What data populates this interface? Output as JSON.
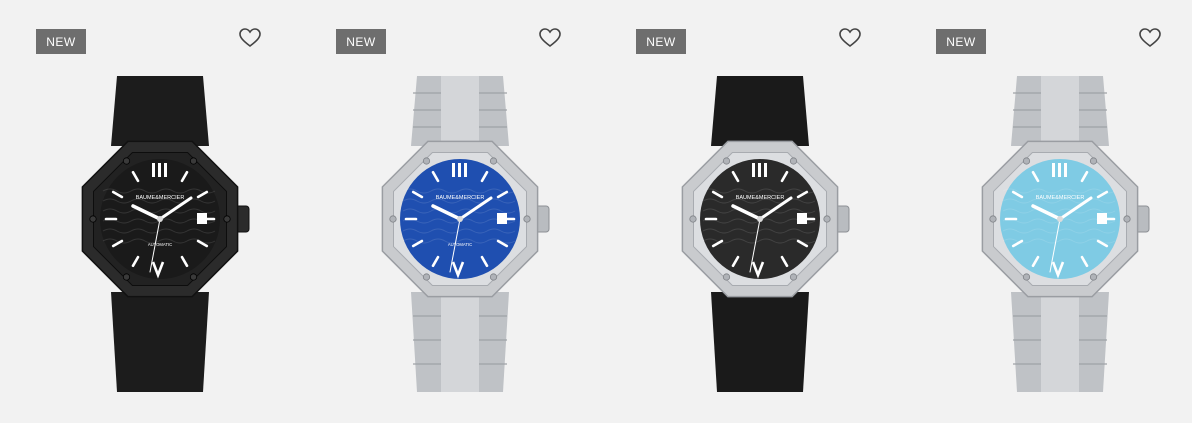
{
  "products": [
    {
      "badge": "NEW",
      "icon": "heart-outline-icon",
      "dial_color": "#1a1a1a",
      "case_color": "#2b2b2b",
      "strap": "rubber",
      "strap_color": "#1c1c1c",
      "logo": "BAUME&MERCIER",
      "sublabel": "AUTOMATIC"
    },
    {
      "badge": "NEW",
      "icon": "heart-outline-icon",
      "dial_color": "#1f4fb0",
      "case_color": "#c9cbce",
      "strap": "bracelet",
      "strap_color": "#bfc2c6",
      "logo": "BAUME&MERCIER",
      "sublabel": "AUTOMATIC"
    },
    {
      "badge": "NEW",
      "icon": "heart-outline-icon",
      "dial_color": "#2a2a2a",
      "case_color": "#c9cbce",
      "strap": "rubber",
      "strap_color": "#1a1a1a",
      "logo": "BAUME&MERCIER",
      "sublabel": ""
    },
    {
      "badge": "NEW",
      "icon": "heart-outline-icon",
      "dial_color": "#7fcbe4",
      "case_color": "#c9cbce",
      "strap": "bracelet",
      "strap_color": "#bfc2c6",
      "logo": "BAUME&MERCIER",
      "sublabel": ""
    }
  ]
}
